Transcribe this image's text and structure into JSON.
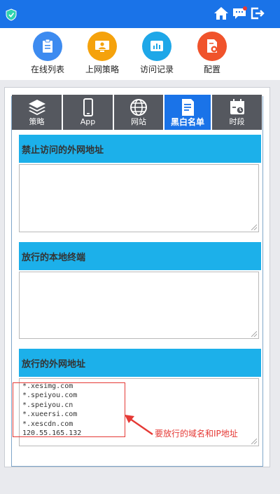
{
  "quick_nav": [
    {
      "label": "在线列表",
      "icon": "clipboard-icon",
      "color": "#3d8bf0"
    },
    {
      "label": "上网策略",
      "icon": "user-screen-icon",
      "color": "#f5a20c"
    },
    {
      "label": "访问记录",
      "icon": "bar-chart-icon",
      "color": "#1ea7e8"
    },
    {
      "label": "配置",
      "icon": "gear-file-icon",
      "color": "#f0532b"
    }
  ],
  "tabs": [
    {
      "label": "策略",
      "icon": "layers-icon",
      "active": false
    },
    {
      "label": "App",
      "icon": "phone-icon",
      "active": false
    },
    {
      "label": "网站",
      "icon": "globe-icon",
      "active": false
    },
    {
      "label": "黑白名单",
      "icon": "document-list-icon",
      "active": true
    },
    {
      "label": "时段",
      "icon": "calendar-clock-icon",
      "active": false
    }
  ],
  "sections": {
    "blocked_external": {
      "title": "禁止访问的外网地址",
      "value": ""
    },
    "allowed_local": {
      "title": "放行的本地终端",
      "value": ""
    },
    "allowed_external": {
      "title": "放行的外网地址",
      "entries": [
        "*.xesimg.com",
        "*.speiyou.com",
        "*.speiyou.cn",
        "*.xueersi.com",
        "*.xescdn.com",
        "120.55.165.132"
      ]
    }
  },
  "annotation": "要放行的域名和IP地址",
  "colors": {
    "primary": "#1a73e8",
    "section_header": "#1cb0ea",
    "tab_inactive": "#55585f",
    "annotation": "#e53935"
  }
}
